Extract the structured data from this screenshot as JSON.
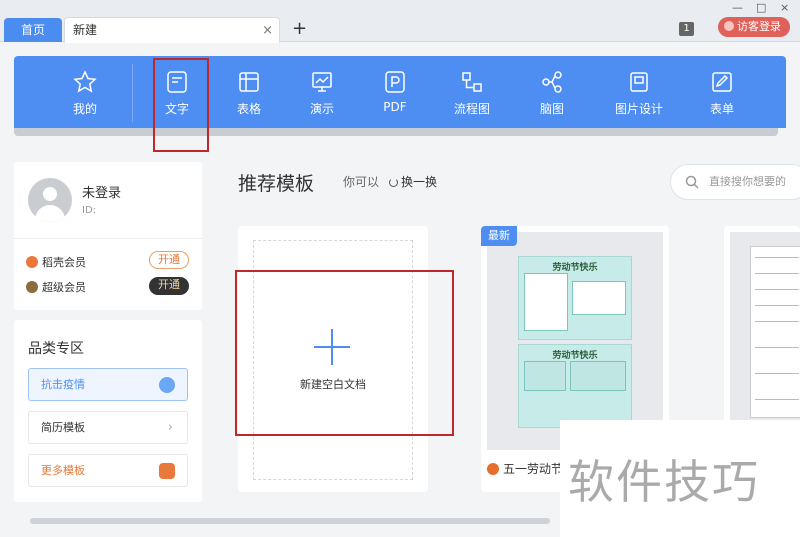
{
  "tabs": {
    "home_label": "首页",
    "new_label": "新建",
    "close_glyph": "×",
    "add_glyph": "+"
  },
  "window": {
    "badge_count": "1",
    "login_label": "访客登录",
    "minimize_glyph": "—",
    "maximize_glyph": "□",
    "close_glyph": "×"
  },
  "toolbar": {
    "items": [
      {
        "label": "我的",
        "icon": "star-icon"
      },
      {
        "label": "文字",
        "icon": "document-icon"
      },
      {
        "label": "表格",
        "icon": "table-icon"
      },
      {
        "label": "演示",
        "icon": "presentation-icon"
      },
      {
        "label": "PDF",
        "icon": "pdf-icon"
      },
      {
        "label": "流程图",
        "icon": "flowchart-icon"
      },
      {
        "label": "脑图",
        "icon": "mindmap-icon"
      },
      {
        "label": "图片设计",
        "icon": "image-design-icon"
      },
      {
        "label": "表单",
        "icon": "form-icon"
      }
    ],
    "selected": "文字"
  },
  "user": {
    "name": "未登录",
    "id_label": "ID:",
    "vip": [
      {
        "label": "稻壳会员",
        "button": "开通",
        "color": "#e8793a"
      },
      {
        "label": "超级会员",
        "button": "开通",
        "color": "#8a6d3b"
      }
    ]
  },
  "categories": {
    "title": "品类专区",
    "items": [
      "抗击疫情",
      "简历模板",
      "更多模板"
    ],
    "chevron": "›"
  },
  "main": {
    "section_title": "推荐模板",
    "hint": "你可以",
    "refresh_label": "换一换",
    "search_placeholder": "直接搜你想要的",
    "blank_label": "新建空白文档",
    "template_badge": "最新",
    "template_page_title": "劳动节快乐",
    "template_name": "五一劳动节"
  },
  "watermark": "软件技巧",
  "colors": {
    "accent": "#4e8ef2",
    "highlight": "#c0272d",
    "login": "#e0605a"
  }
}
